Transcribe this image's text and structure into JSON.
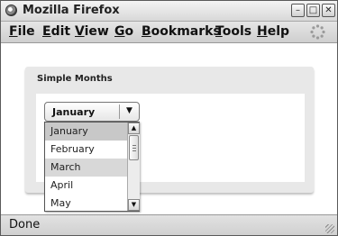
{
  "window": {
    "title": "Mozilla Firefox"
  },
  "menubar": {
    "items": [
      "File",
      "Edit",
      "View",
      "Go",
      "Bookmarks",
      "Tools",
      "Help"
    ]
  },
  "panel": {
    "title": "Simple Months"
  },
  "combo": {
    "selected": "January",
    "options": [
      "January",
      "February",
      "March",
      "April",
      "May"
    ],
    "hovered": "March"
  },
  "status": {
    "text": "Done"
  },
  "icons": {
    "minimize": "minimize-icon",
    "maximize": "maximize-icon",
    "close": "close-icon",
    "dropdown_arrow": "triangle-down-icon",
    "scroll_up": "triangle-up-icon",
    "scroll_down": "triangle-down-icon"
  }
}
